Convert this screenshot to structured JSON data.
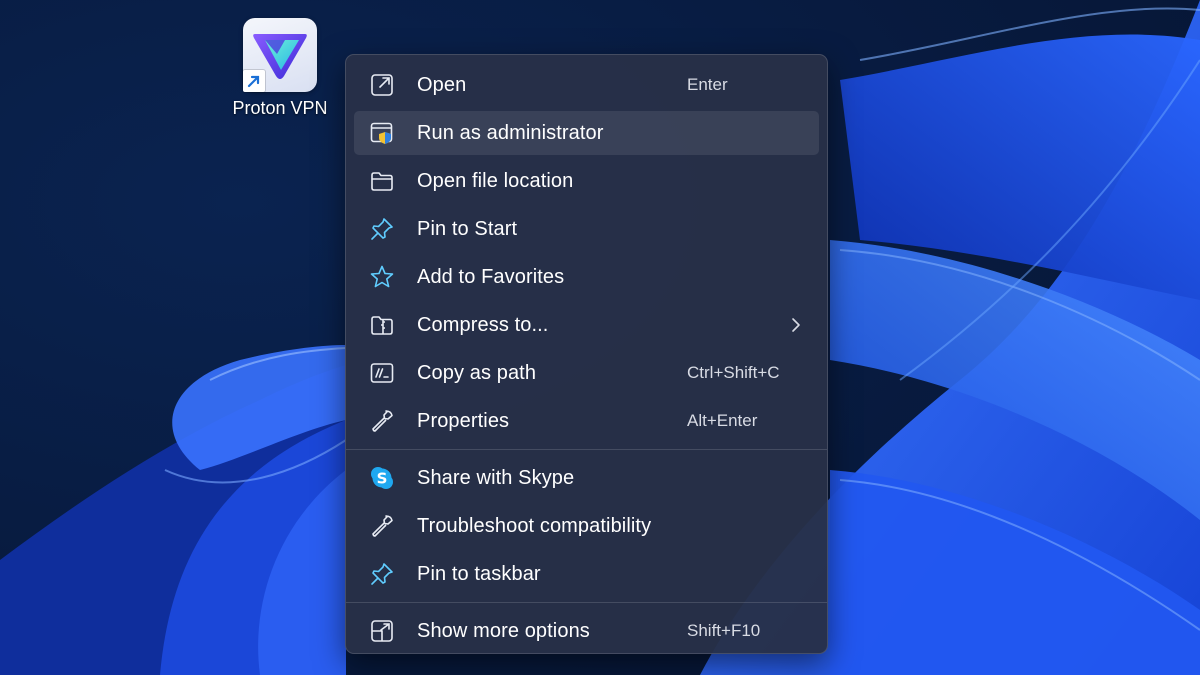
{
  "desktop": {
    "app_label": "Proton VPN"
  },
  "menu": {
    "groups": [
      [
        {
          "label": "Open",
          "shortcut": "Enter",
          "icon": "open-icon"
        },
        {
          "label": "Run as administrator",
          "shortcut": "",
          "icon": "admin-shield-icon",
          "selected": true
        },
        {
          "label": "Open file location",
          "shortcut": "",
          "icon": "folder-icon"
        },
        {
          "label": "Pin to Start",
          "shortcut": "",
          "icon": "pin-icon"
        },
        {
          "label": "Add to Favorites",
          "shortcut": "",
          "icon": "star-icon"
        },
        {
          "label": "Compress to...",
          "shortcut": "",
          "icon": "zip-folder-icon",
          "submenu": true
        },
        {
          "label": "Copy as path",
          "shortcut": "Ctrl+Shift+C",
          "icon": "path-icon"
        },
        {
          "label": "Properties",
          "shortcut": "Alt+Enter",
          "icon": "wrench-icon"
        }
      ],
      [
        {
          "label": "Share with Skype",
          "shortcut": "",
          "icon": "skype-icon"
        },
        {
          "label": "Troubleshoot compatibility",
          "shortcut": "",
          "icon": "wrench-icon"
        },
        {
          "label": "Pin to taskbar",
          "shortcut": "",
          "icon": "pin-icon"
        }
      ],
      [
        {
          "label": "Show more options",
          "shortcut": "Shift+F10",
          "icon": "more-options-icon"
        }
      ]
    ]
  },
  "colors": {
    "accent": "#60cdff",
    "menu_bg": "#283048",
    "wallpaper_dark": "#071a3e",
    "wallpaper_blue": "#1e56e8"
  }
}
